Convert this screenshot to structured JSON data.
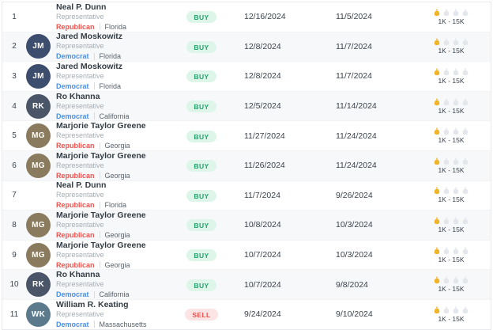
{
  "colors": {
    "buy_text": "#23a26d",
    "buy_bg": "#def5e9",
    "sell_text": "#e8514d",
    "sell_bg": "#fde4e4",
    "republican": "#f0534e",
    "democrat": "#4a8fe2",
    "gold_bag": "#f0b429",
    "empty_bag": "#e3e6ea"
  },
  "table": {
    "rows": [
      {
        "number": "1",
        "name": "Neal P. Dunn",
        "role": "Representative",
        "party": "Republican",
        "state": "Florida",
        "avatar": null,
        "action": "BUY",
        "date1": "12/16/2024",
        "date2": "11/5/2024",
        "amount": "1K - 15K",
        "bags_filled": 1,
        "bags_total": 4
      },
      {
        "number": "2",
        "name": "Jared Moskowitz",
        "role": "Representative",
        "party": "Democrat",
        "state": "Florida",
        "avatar": {
          "initials": "JM",
          "color": "#3d4d6e"
        },
        "action": "BUY",
        "date1": "12/8/2024",
        "date2": "11/7/2024",
        "amount": "1K - 15K",
        "bags_filled": 1,
        "bags_total": 4
      },
      {
        "number": "3",
        "name": "Jared Moskowitz",
        "role": "Representative",
        "party": "Democrat",
        "state": "Florida",
        "avatar": {
          "initials": "JM",
          "color": "#3d4d6e"
        },
        "action": "BUY",
        "date1": "12/8/2024",
        "date2": "11/7/2024",
        "amount": "1K - 15K",
        "bags_filled": 1,
        "bags_total": 4
      },
      {
        "number": "4",
        "name": "Ro Khanna",
        "role": "Representative",
        "party": "Democrat",
        "state": "California",
        "avatar": {
          "initials": "RK",
          "color": "#4a5568"
        },
        "action": "BUY",
        "date1": "12/5/2024",
        "date2": "11/14/2024",
        "amount": "1K - 15K",
        "bags_filled": 1,
        "bags_total": 4
      },
      {
        "number": "5",
        "name": "Marjorie Taylor Greene",
        "role": "Representative",
        "party": "Republican",
        "state": "Georgia",
        "avatar": {
          "initials": "MG",
          "color": "#8a7a5e"
        },
        "action": "BUY",
        "date1": "11/27/2024",
        "date2": "11/24/2024",
        "amount": "1K - 15K",
        "bags_filled": 1,
        "bags_total": 4
      },
      {
        "number": "6",
        "name": "Marjorie Taylor Greene",
        "role": "Representative",
        "party": "Republican",
        "state": "Georgia",
        "avatar": {
          "initials": "MG",
          "color": "#8a7a5e"
        },
        "action": "BUY",
        "date1": "11/26/2024",
        "date2": "11/24/2024",
        "amount": "1K - 15K",
        "bags_filled": 1,
        "bags_total": 4
      },
      {
        "number": "7",
        "name": "Neal P. Dunn",
        "role": "Representative",
        "party": "Republican",
        "state": "Florida",
        "avatar": null,
        "action": "BUY",
        "date1": "11/7/2024",
        "date2": "9/26/2024",
        "amount": "1K - 15K",
        "bags_filled": 1,
        "bags_total": 4
      },
      {
        "number": "8",
        "name": "Marjorie Taylor Greene",
        "role": "Representative",
        "party": "Republican",
        "state": "Georgia",
        "avatar": {
          "initials": "MG",
          "color": "#8a7a5e"
        },
        "action": "BUY",
        "date1": "10/8/2024",
        "date2": "10/3/2024",
        "amount": "1K - 15K",
        "bags_filled": 1,
        "bags_total": 4
      },
      {
        "number": "9",
        "name": "Marjorie Taylor Greene",
        "role": "Representative",
        "party": "Republican",
        "state": "Georgia",
        "avatar": {
          "initials": "MG",
          "color": "#8a7a5e"
        },
        "action": "BUY",
        "date1": "10/7/2024",
        "date2": "10/3/2024",
        "amount": "1K - 15K",
        "bags_filled": 1,
        "bags_total": 4
      },
      {
        "number": "10",
        "name": "Ro Khanna",
        "role": "Representative",
        "party": "Democrat",
        "state": "California",
        "avatar": {
          "initials": "RK",
          "color": "#4a5568"
        },
        "action": "BUY",
        "date1": "10/7/2024",
        "date2": "9/8/2024",
        "amount": "1K - 15K",
        "bags_filled": 1,
        "bags_total": 4
      },
      {
        "number": "11",
        "name": "William R. Keating",
        "role": "Representative",
        "party": "Democrat",
        "state": "Massachusetts",
        "avatar": {
          "initials": "WK",
          "color": "#5b7a8c"
        },
        "action": "SELL",
        "date1": "9/24/2024",
        "date2": "9/10/2024",
        "amount": "1K - 15K",
        "bags_filled": 1,
        "bags_total": 4
      }
    ]
  }
}
